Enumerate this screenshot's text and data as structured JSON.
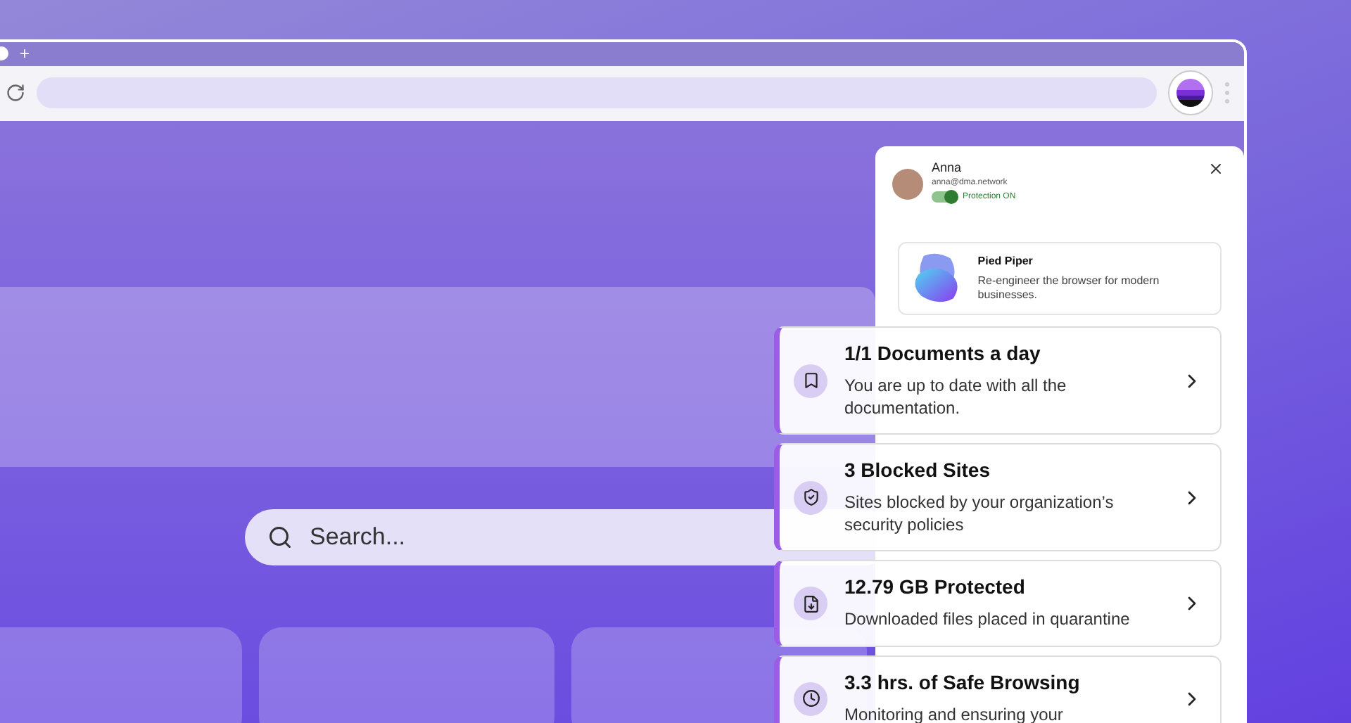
{
  "browser": {
    "new_tab": "+"
  },
  "search": {
    "placeholder": "Search..."
  },
  "profile": {
    "name": "Anna",
    "email": "anna@dma.network",
    "protection": {
      "on": true,
      "label": "Protection ON"
    }
  },
  "org": {
    "name": "Pied Piper",
    "description": "Re-engineer the browser for modern businesses."
  },
  "cards": [
    {
      "kind": "bookmark",
      "title": "1/1 Documents a day",
      "description": "You are up to date with all the documentation."
    },
    {
      "kind": "shield",
      "title": "3 Blocked Sites",
      "description": "Sites blocked by your organization’s security policies"
    },
    {
      "kind": "download",
      "title": "12.79 GB Protected",
      "description": "Downloaded files placed in quarantine"
    },
    {
      "kind": "clock",
      "title": "3.3 hrs. of Safe Browsing",
      "description": "Monitoring and ensuring your"
    }
  ]
}
